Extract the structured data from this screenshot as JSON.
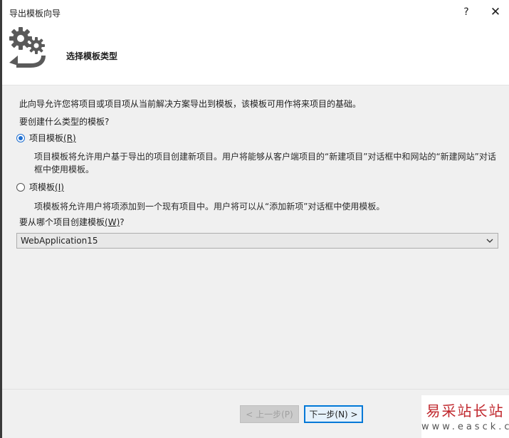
{
  "window": {
    "title": "导出模板向导",
    "help_label": "?",
    "close_label": "✕"
  },
  "header": {
    "icon": "gears-arrow-icon",
    "title": "选择模板类型"
  },
  "content": {
    "intro": "此向导允许您将项目或项目项从当前解决方案导出到模板，该模板可用作将来项目的基础。",
    "question": "要创建什么类型的模板?",
    "options": [
      {
        "label": "项目模板",
        "accelerator": "(R)",
        "selected": true,
        "description_line1": "项目模板将允许用户基于导出的项目创建新项目。用户将能够从客户端项目的“新建项目”对话框中和网站的“新建网站”对话",
        "description_line2": "框中使用模板。"
      },
      {
        "label": "项模板",
        "accelerator": "(I)",
        "selected": false,
        "description_line1": "项模板将允许用户将项添加到一个现有项目中。用户将可以从“添加新项”对话框中使用模板。"
      }
    ],
    "project_prompt": "要从哪个项目创建模板",
    "project_prompt_accelerator": "(W)",
    "project_prompt_suffix": "?",
    "project_selected": "WebApplication15"
  },
  "footer": {
    "prev_label": "< 上一步(P)",
    "next_label": "下一步(N) >"
  },
  "watermark": {
    "brand": "易采站长站",
    "url": "www.easck.com"
  },
  "colors": {
    "accent": "#0078d7",
    "radio": "#1f6fd1",
    "panel": "#f0f0f0",
    "watermark": "#c0272d"
  }
}
